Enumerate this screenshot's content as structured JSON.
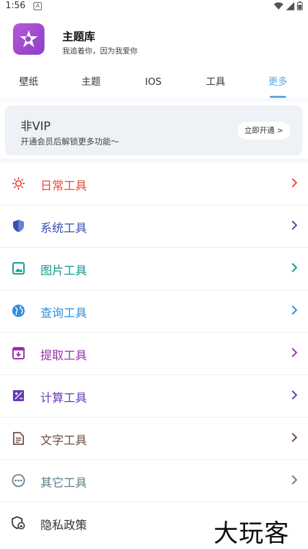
{
  "status_bar": {
    "time": "1:56",
    "notification_letter": "A"
  },
  "header": {
    "title": "主题库",
    "subtitle": "我追着你，因为我爱你"
  },
  "tabs": [
    {
      "label": "壁纸",
      "active": false
    },
    {
      "label": "主题",
      "active": false
    },
    {
      "label": "IOS",
      "active": false
    },
    {
      "label": "工具",
      "active": false
    },
    {
      "label": "更多",
      "active": true
    }
  ],
  "accent_color": "#58a7e6",
  "vip": {
    "title": "非VIP",
    "description": "开通会员后解锁更多功能～",
    "button_label": "立即开通 >"
  },
  "tools": [
    {
      "label": "日常工具",
      "color": "#e8473b",
      "icon": "sun-icon"
    },
    {
      "label": "系统工具",
      "color": "#3a4fb0",
      "icon": "shield-icon"
    },
    {
      "label": "图片工具",
      "color": "#11998e",
      "icon": "image-icon"
    },
    {
      "label": "查询工具",
      "color": "#2f8fdc",
      "icon": "globe-icon"
    },
    {
      "label": "提取工具",
      "color": "#9b2fae",
      "icon": "archive-icon"
    },
    {
      "label": "计算工具",
      "color": "#673ab7",
      "icon": "calculator-icon"
    },
    {
      "label": "文字工具",
      "color": "#6d4c41",
      "icon": "document-icon"
    },
    {
      "label": "其它工具",
      "color": "#607d8b",
      "icon": "more-icon"
    },
    {
      "label": "隐私政策",
      "color": "#333333",
      "icon": "privacy-icon"
    }
  ],
  "watermark": "大玩客"
}
